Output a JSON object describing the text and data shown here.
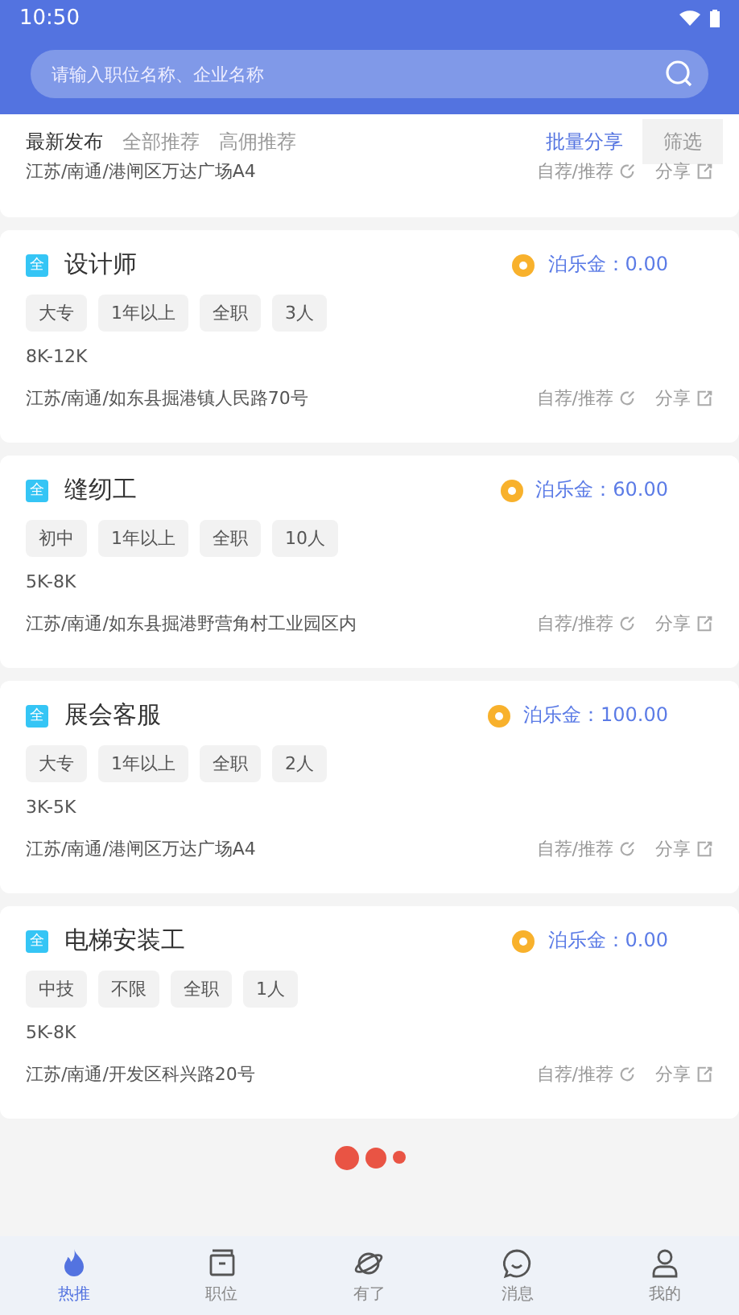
{
  "status_bar": {
    "time": "10:50"
  },
  "search": {
    "placeholder": "请输入职位名称、企业名称"
  },
  "tabs": [
    {
      "label": "最新发布",
      "selected": true
    },
    {
      "label": "全部推荐",
      "selected": false
    },
    {
      "label": "高佣推荐",
      "selected": false
    }
  ],
  "batch_share": "批量分享",
  "filter": "筛选",
  "partial_job": {
    "address": "江苏/南通/港闸区万达广场A4",
    "recommend": "自荐/推荐",
    "share": "分享"
  },
  "jobs": [
    {
      "badge": "全",
      "title": "设计师",
      "bonus": "泊乐金：0.00",
      "tags": [
        "大专",
        "1年以上",
        "全职",
        "3人"
      ],
      "salary": "8K-12K",
      "address": "江苏/南通/如东县掘港镇人民路70号",
      "recommend": "自荐/推荐",
      "share": "分享"
    },
    {
      "badge": "全",
      "title": "缝纫工",
      "bonus": "泊乐金：60.00",
      "tags": [
        "初中",
        "1年以上",
        "全职",
        "10人"
      ],
      "salary": "5K-8K",
      "address": "江苏/南通/如东县掘港野营角村工业园区内",
      "recommend": "自荐/推荐",
      "share": "分享"
    },
    {
      "badge": "全",
      "title": "展会客服",
      "bonus": "泊乐金：100.00",
      "tags": [
        "大专",
        "1年以上",
        "全职",
        "2人"
      ],
      "salary": "3K-5K",
      "address": "江苏/南通/港闸区万达广场A4",
      "recommend": "自荐/推荐",
      "share": "分享"
    },
    {
      "badge": "全",
      "title": "电梯安装工",
      "bonus": "泊乐金：0.00",
      "tags": [
        "中技",
        "不限",
        "全职",
        "1人"
      ],
      "salary": "5K-8K",
      "address": "江苏/南通/开发区科兴路20号",
      "recommend": "自荐/推荐",
      "share": "分享"
    }
  ],
  "nav": [
    {
      "label": "热推",
      "kind": "fire",
      "selected": true
    },
    {
      "label": "职位",
      "kind": "box",
      "selected": false
    },
    {
      "label": "有了",
      "kind": "planet",
      "selected": false
    },
    {
      "label": "消息",
      "kind": "chat",
      "selected": false
    },
    {
      "label": "我的",
      "kind": "user",
      "selected": false
    }
  ]
}
